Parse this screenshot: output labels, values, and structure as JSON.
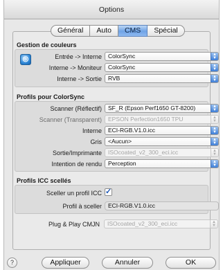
{
  "window": {
    "title": "Options"
  },
  "tabs": [
    {
      "label": "Général",
      "active": false
    },
    {
      "label": "Auto",
      "active": false
    },
    {
      "label": "CMS",
      "active": true
    },
    {
      "label": "Spécial",
      "active": false
    }
  ],
  "gestion": {
    "title": "Gestion de couleurs",
    "icon": "colorsync-icon",
    "rows": [
      {
        "label": "Entrée -> Interne",
        "value": "ColorSync"
      },
      {
        "label": "Interne -> Moniteur",
        "value": "ColorSync"
      },
      {
        "label": "Interne -> Sortie",
        "value": "RVB"
      }
    ]
  },
  "profils": {
    "title": "Profils pour ColorSync",
    "rows": [
      {
        "label": "Scanner (Réflectif)",
        "value": "SF_R (Epson Perf1650 GT-8200)",
        "enabled": true
      },
      {
        "label": "Scanner (Transparent)",
        "value": "EPSON Perfection1650 TPU",
        "enabled": false
      },
      {
        "label": "Interne",
        "value": "ECI-RGB.V1.0.icc",
        "enabled": true
      },
      {
        "label": "Gris",
        "value": "<Aucun>",
        "enabled": true
      },
      {
        "label": "Sortie/Imprimante",
        "value": "ISOcoated_v2_300_eci.icc",
        "enabled": false
      },
      {
        "label": "Intention de rendu",
        "value": "Perception",
        "enabled": true
      }
    ]
  },
  "icc": {
    "title": "Profils ICC scellés",
    "seal_label": "Sceller un profil ICC",
    "seal_checked": true,
    "seal_mark": "✓",
    "profile_label": "Profil à sceller",
    "profile_value": "ECI-RGB.V1.0.icc",
    "plug_label": "Plug & Play CMJN",
    "plug_value": "ISOcoated_v2_300_eci.icc"
  },
  "footer": {
    "help": "?",
    "apply": "Appliquer",
    "cancel": "Annuler",
    "ok": "OK"
  },
  "colors": {
    "accent": "#6fa3e6",
    "window_bg": "#e8e8e8"
  }
}
